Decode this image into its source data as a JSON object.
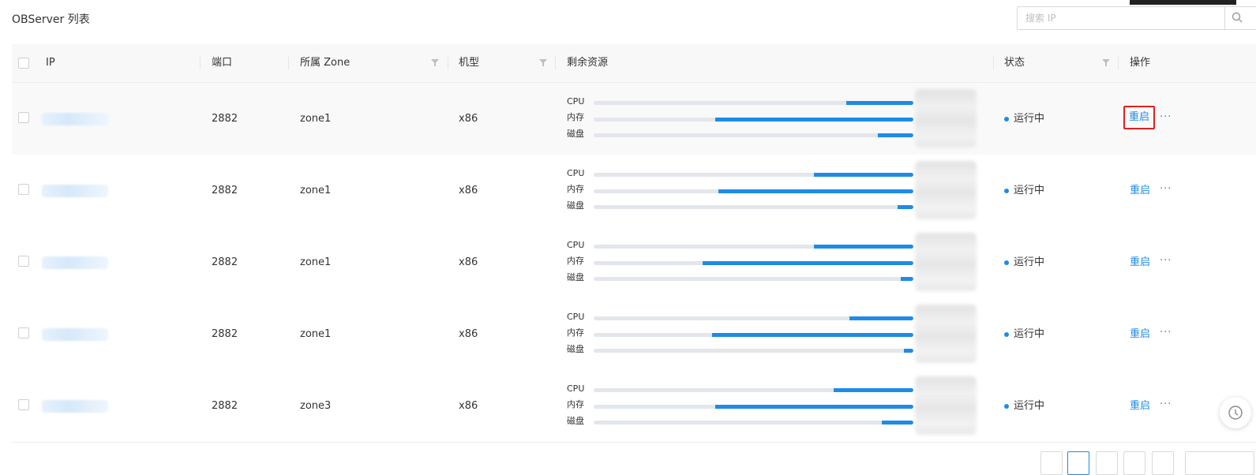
{
  "page": {
    "title": "OBServer 列表"
  },
  "search": {
    "placeholder": "搜索 IP"
  },
  "columns": {
    "ip": "IP",
    "port": "端口",
    "zone": "所属 Zone",
    "arch": "机型",
    "resources": "剩余资源",
    "status": "状态",
    "actions": "操作"
  },
  "resource_labels": {
    "cpu": "CPU",
    "memory": "内存",
    "disk": "磁盘"
  },
  "rows": [
    {
      "port": "2882",
      "zone": "zone1",
      "arch": "x86",
      "status": "运行中",
      "action": "重启",
      "cpu": 0.21,
      "memory": 0.62,
      "disk": 0.11
    },
    {
      "port": "2882",
      "zone": "zone1",
      "arch": "x86",
      "status": "运行中",
      "action": "重启",
      "cpu": 0.31,
      "memory": 0.61,
      "disk": 0.05
    },
    {
      "port": "2882",
      "zone": "zone1",
      "arch": "x86",
      "status": "运行中",
      "action": "重启",
      "cpu": 0.31,
      "memory": 0.66,
      "disk": 0.04
    },
    {
      "port": "2882",
      "zone": "zone1",
      "arch": "x86",
      "status": "运行中",
      "action": "重启",
      "cpu": 0.2,
      "memory": 0.63,
      "disk": 0.03
    },
    {
      "port": "2882",
      "zone": "zone3",
      "arch": "x86",
      "status": "运行中",
      "action": "重启",
      "cpu": 0.25,
      "memory": 0.62,
      "disk": 0.1
    }
  ],
  "colors": {
    "accent": "#1e8be6",
    "highlight": "#e02020",
    "track": "#e3e6ea"
  },
  "icons": {
    "search": "search-icon",
    "filter": "filter-icon",
    "more": "more-icon",
    "help": "help-icon"
  }
}
